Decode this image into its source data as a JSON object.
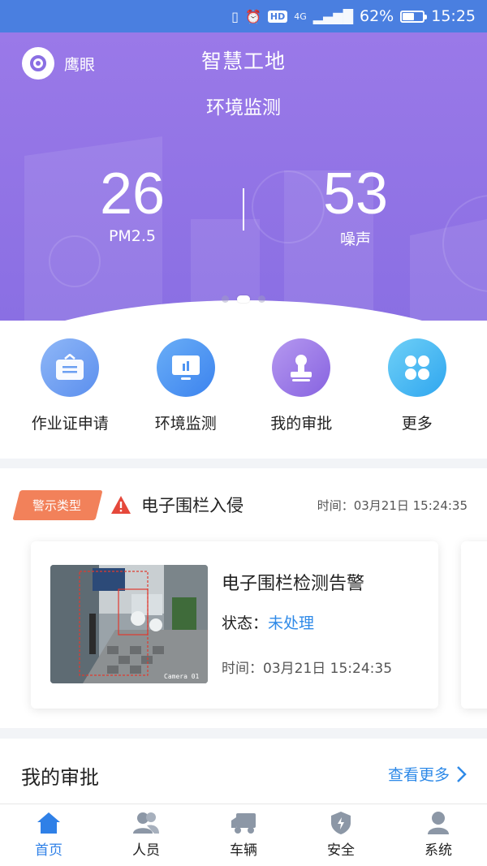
{
  "status_bar": {
    "battery": "62%",
    "time": "15:25",
    "network": "4G",
    "hd": "HD"
  },
  "hero": {
    "brand": "鹰眼",
    "app_title": "智慧工地",
    "subtitle": "环境监测",
    "metrics": [
      {
        "value": "26",
        "label": "PM2.5"
      },
      {
        "value": "53",
        "label": "噪声"
      }
    ],
    "carousel": {
      "pages": 3,
      "active": 2
    }
  },
  "quick_actions": [
    {
      "label": "作业证申请",
      "icon": "certificate-icon",
      "color": "#6b9ff2"
    },
    {
      "label": "环境监测",
      "icon": "monitor-icon",
      "color": "#4f95f2"
    },
    {
      "label": "我的审批",
      "icon": "stamp-icon",
      "color": "#9d78e8"
    },
    {
      "label": "更多",
      "icon": "more-grid-icon",
      "color": "#46b8f3"
    }
  ],
  "alert": {
    "tag": "警示类型",
    "type": "电子围栏入侵",
    "time": "时间：03月21日 15:24:35",
    "card": {
      "title": "电子围栏检测告警",
      "status_label": "状态：",
      "status_value": "未处理",
      "time": "时间：03月21日 15:24:35",
      "camera_label": "Camera 01"
    }
  },
  "approvals": {
    "title": "我的审批",
    "more": "查看更多"
  },
  "tabs": [
    {
      "label": "首页",
      "icon": "home-icon",
      "active": true
    },
    {
      "label": "人员",
      "icon": "people-icon",
      "active": false
    },
    {
      "label": "车辆",
      "icon": "truck-icon",
      "active": false
    },
    {
      "label": "安全",
      "icon": "shield-icon",
      "active": false
    },
    {
      "label": "系统",
      "icon": "user-icon",
      "active": false
    }
  ],
  "colors": {
    "accent": "#2f80e7",
    "hero": "#8a6fe3",
    "alert_tag": "#f2815a",
    "warning": "#e5483b"
  }
}
